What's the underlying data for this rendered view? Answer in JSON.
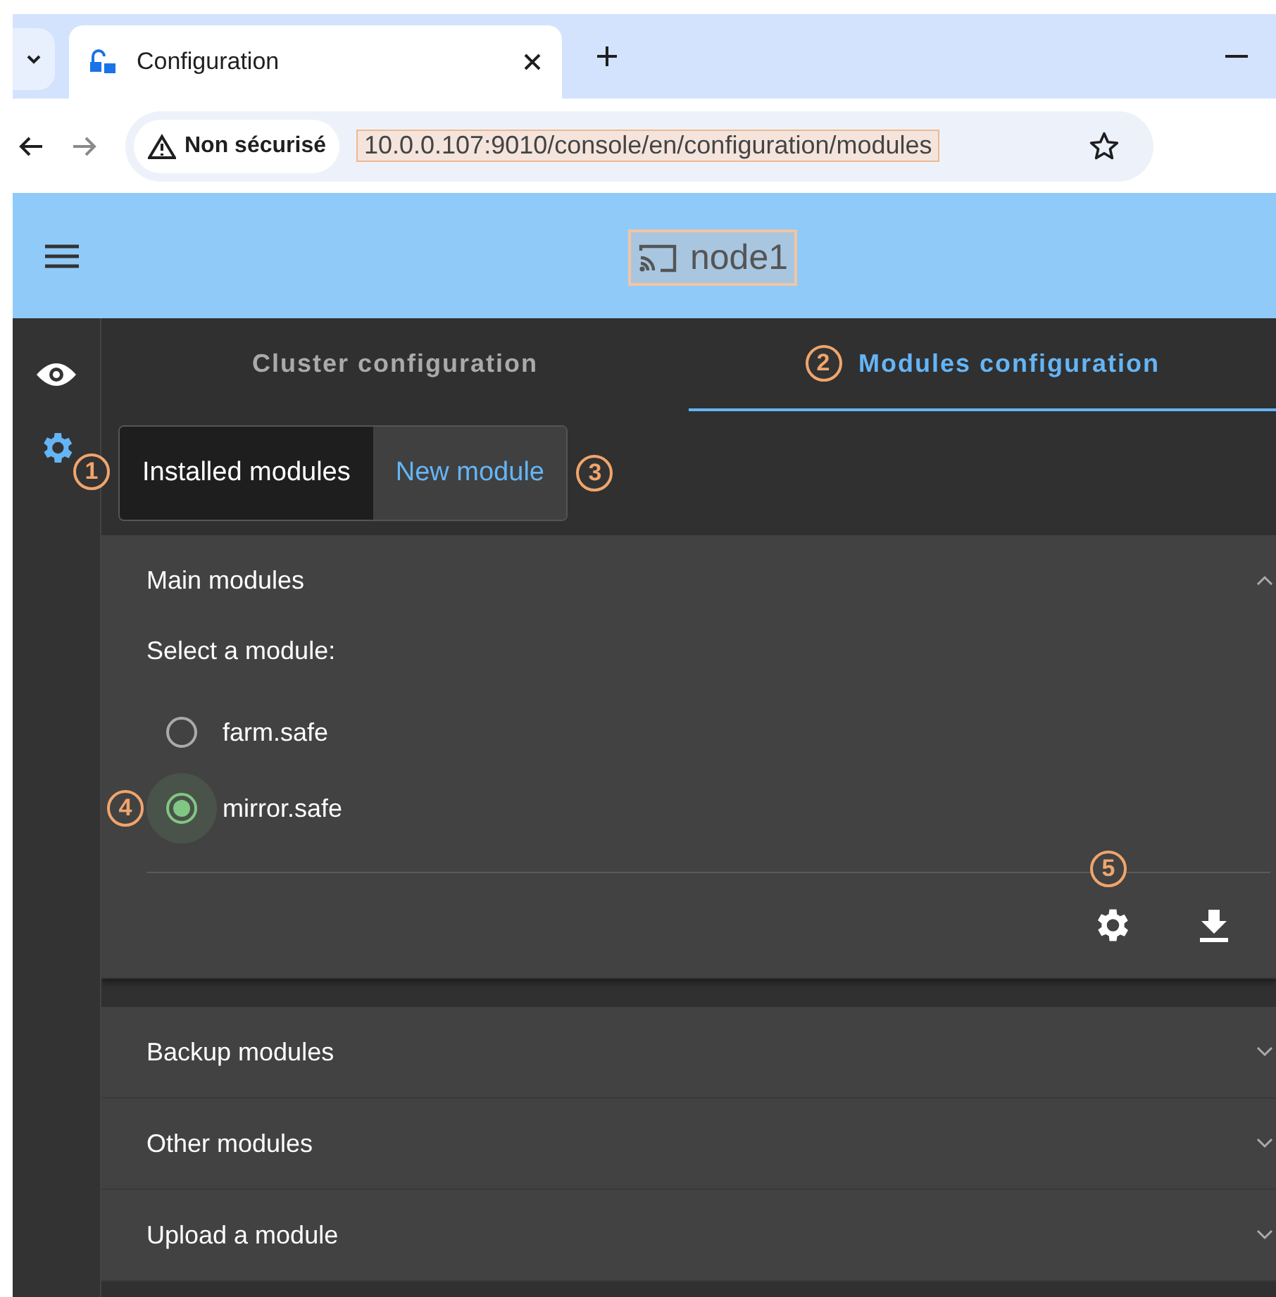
{
  "browser": {
    "tab_title": "Configuration",
    "security": "Non sécurisé",
    "url": "10.0.0.107:9010/console/en/configuration/modules"
  },
  "header": {
    "title": "node1"
  },
  "sidebar": {
    "items": [
      {
        "kind": "eye",
        "selected": false
      },
      {
        "kind": "gear",
        "selected": true
      }
    ]
  },
  "tabs": [
    {
      "label": "Cluster configuration",
      "selected": false
    },
    {
      "label": "Modules configuration",
      "selected": true
    }
  ],
  "subtabs": [
    {
      "label": "Installed modules",
      "selected": true
    },
    {
      "label": "New module",
      "selected": false
    }
  ],
  "sections": [
    {
      "title": "Main modules",
      "expanded": true,
      "prompt": "Select a module:",
      "options": [
        {
          "label": "farm.safe",
          "selected": false
        },
        {
          "label": "mirror.safe",
          "selected": true
        }
      ]
    },
    {
      "title": "Backup modules",
      "expanded": false
    },
    {
      "title": "Other modules",
      "expanded": false
    },
    {
      "title": "Upload a module",
      "expanded": false
    }
  ],
  "callouts": [
    "1",
    "2",
    "3",
    "4",
    "5"
  ]
}
